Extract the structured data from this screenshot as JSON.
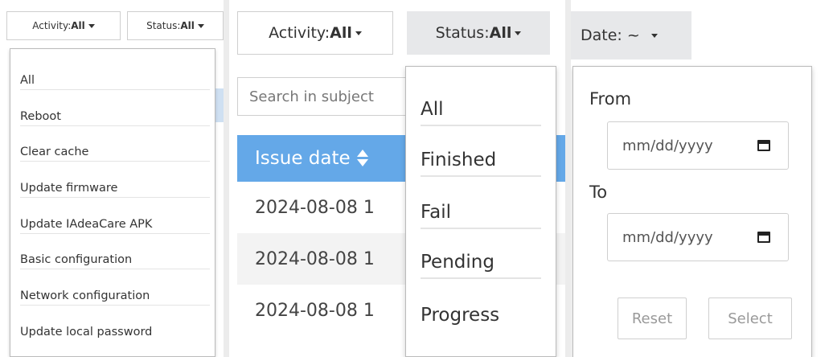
{
  "panel_small": {
    "activity_filter": {
      "label": "Activity: ",
      "value": "All"
    },
    "status_filter": {
      "label": "Status: ",
      "value": "All"
    },
    "activity_menu": [
      "All",
      "Reboot",
      "Clear cache",
      "Update firmware",
      "Update IAdeaCare APK",
      "Basic configuration",
      "Network configuration",
      "Update local password"
    ]
  },
  "panel_table": {
    "activity_filter": {
      "label": "Activity: ",
      "value": "All"
    },
    "status_filter": {
      "label": "Status: ",
      "value": "All"
    },
    "search": {
      "placeholder": "Search in subject"
    },
    "table": {
      "sort_column": "Issue date",
      "rows": [
        "2024-08-08 1",
        "2024-08-08 1",
        "2024-08-08 1"
      ]
    },
    "status_menu": [
      "All",
      "Finished",
      "Fail",
      "Pending",
      "Progress"
    ]
  },
  "panel_date": {
    "date_filter": {
      "label": "Date: ",
      "value": "~"
    },
    "from_label": "From",
    "to_label": "To",
    "from_placeholder": "mm/dd/yyyy",
    "to_placeholder": "mm/dd/yyyy",
    "reset_label": "Reset",
    "select_label": "Select"
  },
  "colors": {
    "header": "#64a8e8",
    "active_button": "#e7e8ea"
  }
}
